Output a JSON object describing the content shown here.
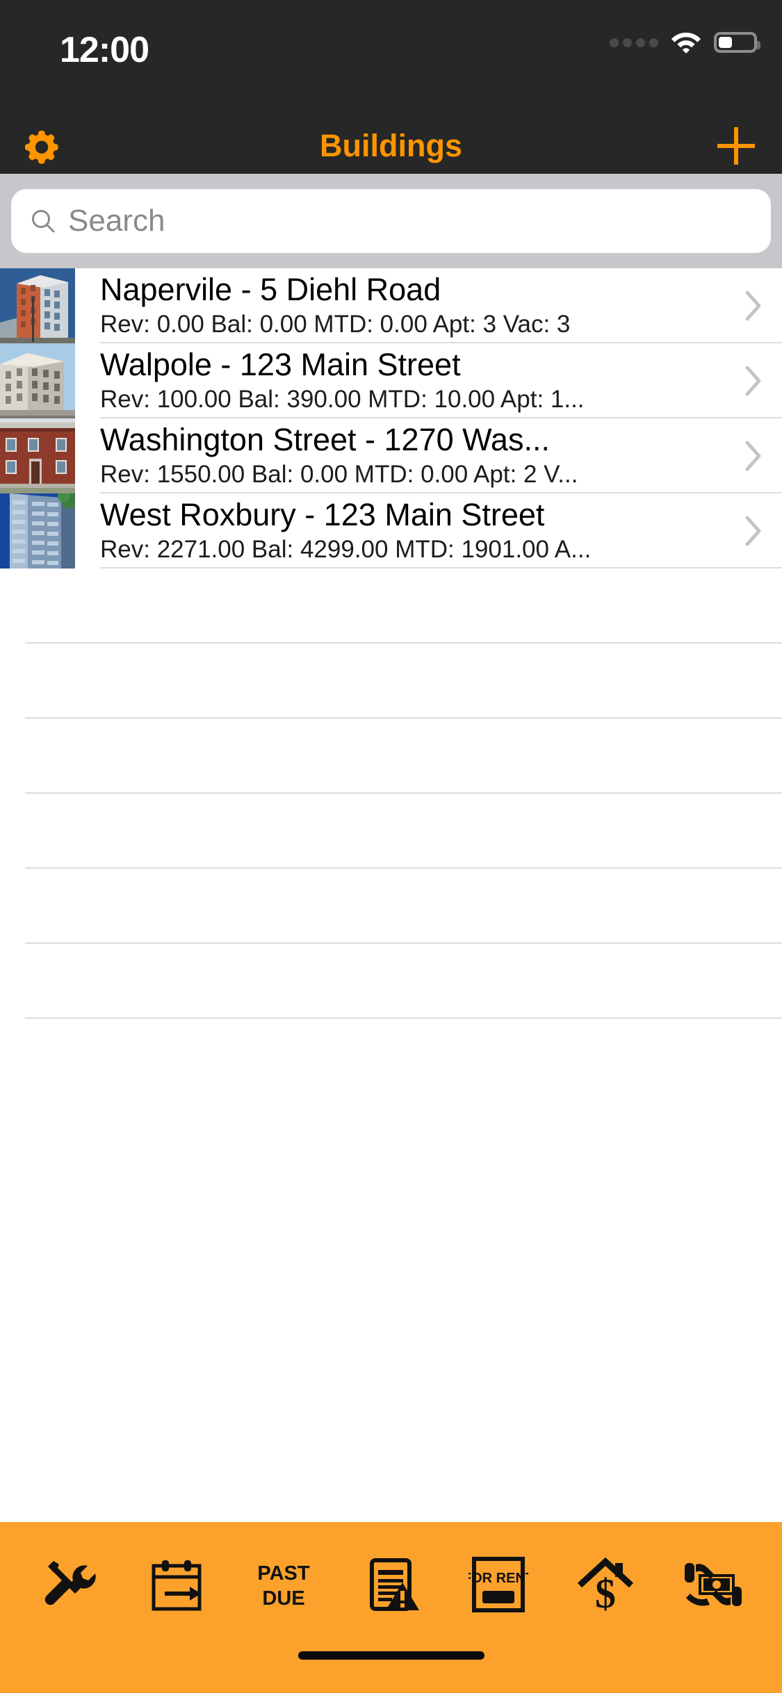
{
  "status_bar": {
    "time": "12:00",
    "signal_icon": "signal-dots-icon",
    "wifi_icon": "wifi-icon",
    "battery_icon": "battery-icon",
    "battery_level_pct": 40
  },
  "nav_bar": {
    "title": "Buildings",
    "left_icon": "gear-icon",
    "right_icon": "plus-icon",
    "tint_color": "#FF9500",
    "background_color": "#272727"
  },
  "search": {
    "placeholder": "Search",
    "value": "",
    "icon": "search-icon"
  },
  "list": {
    "accessory_icon": "chevron-right-icon",
    "items": [
      {
        "title": "Napervile - 5 Diehl Road",
        "subtitle": "Rev: 0.00 Bal: 0.00 MTD: 0.00 Apt: 3 Vac: 3",
        "thumbnail": "building-photo-brick-apartment"
      },
      {
        "title": "Walpole - 123 Main Street",
        "subtitle": "Rev: 100.00 Bal: 390.00 MTD: 10.00 Apt: 1...",
        "thumbnail": "building-photo-stone-corner"
      },
      {
        "title": "Washington Street - 1270 Was...",
        "subtitle": "Rev: 1550.00 Bal: 0.00 MTD: 0.00 Apt: 2 V...",
        "thumbnail": "building-photo-red-brick-rowhouse"
      },
      {
        "title": "West Roxbury - 123 Main Street",
        "subtitle": "Rev: 2271.00 Bal: 4299.00 MTD: 1901.00 A...",
        "thumbnail": "building-photo-glass-tower"
      }
    ],
    "empty_row_count": 6
  },
  "toolbar": {
    "background_color": "#FCA22C",
    "items": [
      {
        "name": "maintenance",
        "icon": "wrench-screwdriver-icon",
        "label": ""
      },
      {
        "name": "lease-expiring",
        "icon": "calendar-arrow-icon",
        "label": ""
      },
      {
        "name": "past-due",
        "icon": "past-due-text-icon",
        "label": "PAST DUE"
      },
      {
        "name": "notices",
        "icon": "document-warning-icon",
        "label": ""
      },
      {
        "name": "for-rent",
        "icon": "for-rent-sign-icon",
        "label": "FOR RENT"
      },
      {
        "name": "rent-roll",
        "icon": "house-dollar-icon",
        "label": ""
      },
      {
        "name": "payments",
        "icon": "hands-cash-icon",
        "label": ""
      }
    ]
  },
  "home_indicator": {
    "visible": true
  }
}
